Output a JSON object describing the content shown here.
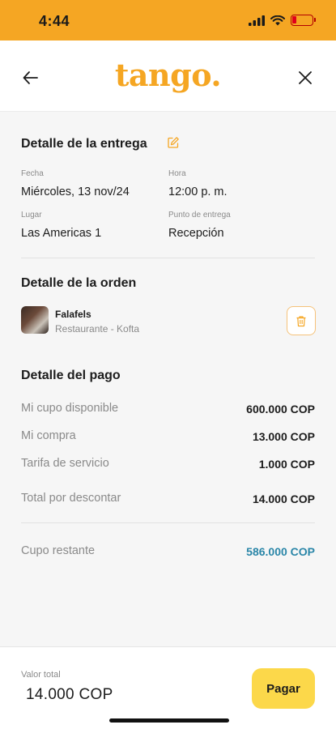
{
  "status_bar": {
    "time": "4:44",
    "icons": [
      "signal-icon",
      "wifi-icon",
      "battery-low-icon"
    ]
  },
  "header": {
    "logo": "tango.",
    "back_icon": "arrow-left-icon",
    "close_icon": "close-icon"
  },
  "delivery": {
    "title": "Detalle de la entrega",
    "edit_icon": "edit-icon",
    "date_label": "Fecha",
    "date_value": "Miércoles, 13 nov/24",
    "time_label": "Hora",
    "time_value": "12:00 p. m.",
    "place_label": "Lugar",
    "place_value": "Las Americas 1",
    "point_label": "Punto de entrega",
    "point_value": "Recepción"
  },
  "order": {
    "title": "Detalle de la orden",
    "item_name": "Falafels",
    "item_subtitle": "Restaurante - Kofta",
    "delete_icon": "trash-icon"
  },
  "payment": {
    "title": "Detalle del pago",
    "rows": [
      {
        "label": "Mi cupo disponible",
        "value": "600.000 COP"
      },
      {
        "label": "Mi compra",
        "value": "13.000 COP"
      },
      {
        "label": "Tarifa de servicio",
        "value": "1.000 COP"
      },
      {
        "label": "Total por descontar",
        "value": "14.000 COP"
      }
    ],
    "remaining_label": "Cupo restante",
    "remaining_value": "586.000 COP"
  },
  "footer": {
    "total_label": "Valor total",
    "total_value": "14.000 COP",
    "pay_button": "Pagar"
  },
  "colors": {
    "brand": "#f5a623",
    "pay_button": "#fcd84a",
    "remaining": "#2a86a8"
  }
}
